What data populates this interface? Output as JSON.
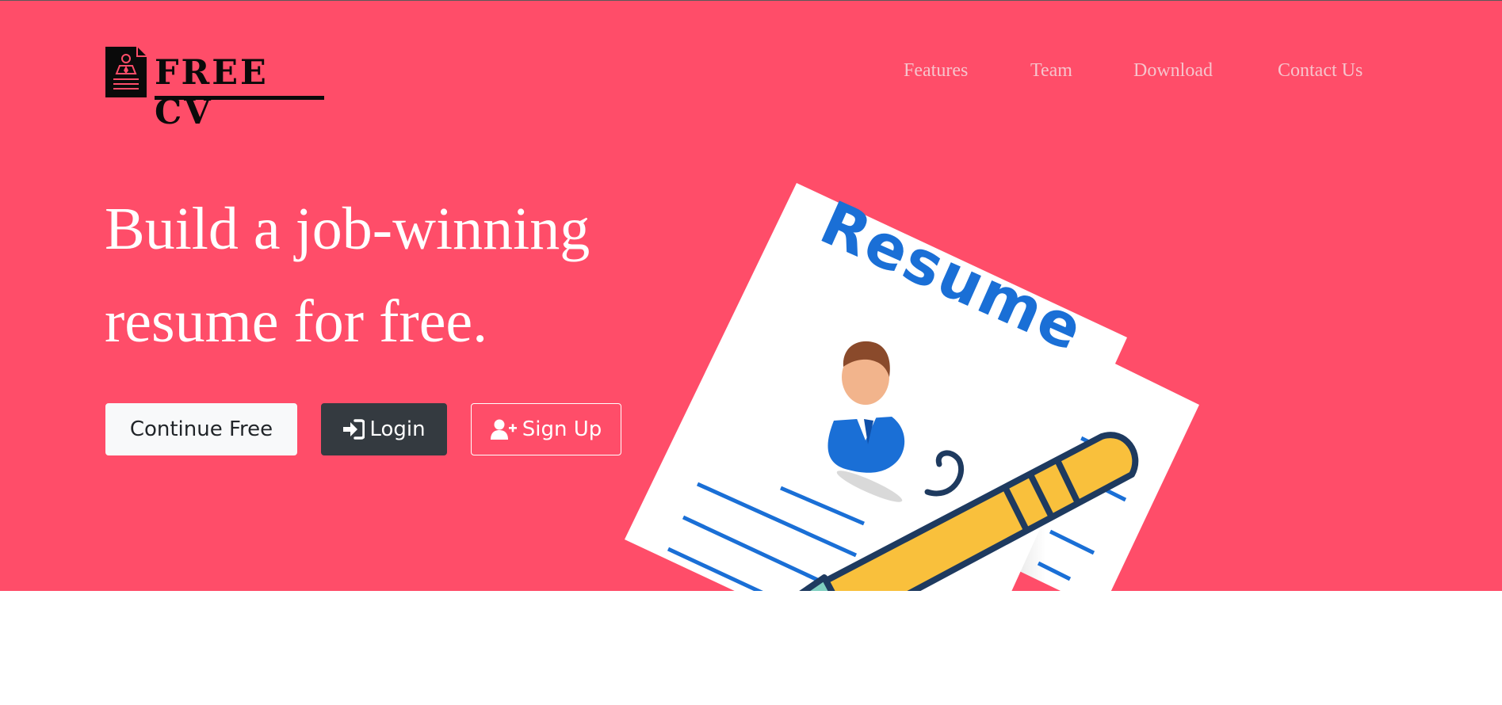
{
  "brand": {
    "name": "FREE CV",
    "icon": "resume-document-icon"
  },
  "nav": {
    "items": [
      {
        "label": "Features"
      },
      {
        "label": "Team"
      },
      {
        "label": "Download"
      },
      {
        "label": "Contact Us"
      }
    ]
  },
  "hero": {
    "headline_line1": "Build a job-winning",
    "headline_line2": "resume for free.",
    "buttons": {
      "continue_free": "Continue Free",
      "login": "Login",
      "login_icon": "sign-in-icon",
      "signup": "Sign Up",
      "signup_icon": "user-plus-icon"
    },
    "illustration_text": "Resume"
  },
  "colors": {
    "hero_background": "#ff4d69",
    "nav_link": "#f6c4cc",
    "login_button": "#343a40",
    "continue_button": "#f8f9fa",
    "illustration_accent": "#1a6fd6",
    "pen_body": "#f9c03c"
  }
}
